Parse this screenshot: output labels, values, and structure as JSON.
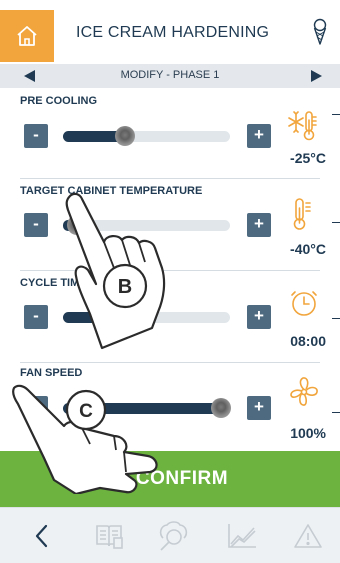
{
  "header": {
    "title": "ICE CREAM HARDENING",
    "home_icon": "home-icon",
    "cone_icon": "ice-cream-cone-icon",
    "accent_color": "#f1a53c"
  },
  "phase_bar": {
    "label": "MODIFY - PHASE 1"
  },
  "controls": [
    {
      "title": "PRE COOLING",
      "value": "-25°C",
      "level": 0.25,
      "icon": "snowflake-thermometer-icon"
    },
    {
      "title": "TARGET CABINET TEMPERATURE",
      "value": "-40°C",
      "level": 0.0,
      "icon": "thermometer-icon"
    },
    {
      "title": "CYCLE TIME",
      "value": "08:00",
      "level": 0.2,
      "icon": "clock-icon"
    },
    {
      "title": "FAN SPEED",
      "value": "100%",
      "level": 1.0,
      "icon": "fan-icon"
    }
  ],
  "buttons": {
    "minus": "-",
    "plus": "+"
  },
  "callouts": {
    "b": "B",
    "c": "C"
  },
  "confirm": {
    "label": "CONFIRM",
    "color": "#6cb33f"
  },
  "bottom_nav": [
    "back-icon",
    "recipe-book-icon",
    "ice-cream-scoop-icon",
    "chart-icon",
    "warning-icon"
  ],
  "colors": {
    "dark": "#1f3a52",
    "button": "#4d6a80",
    "track": "#e1e6ea"
  }
}
